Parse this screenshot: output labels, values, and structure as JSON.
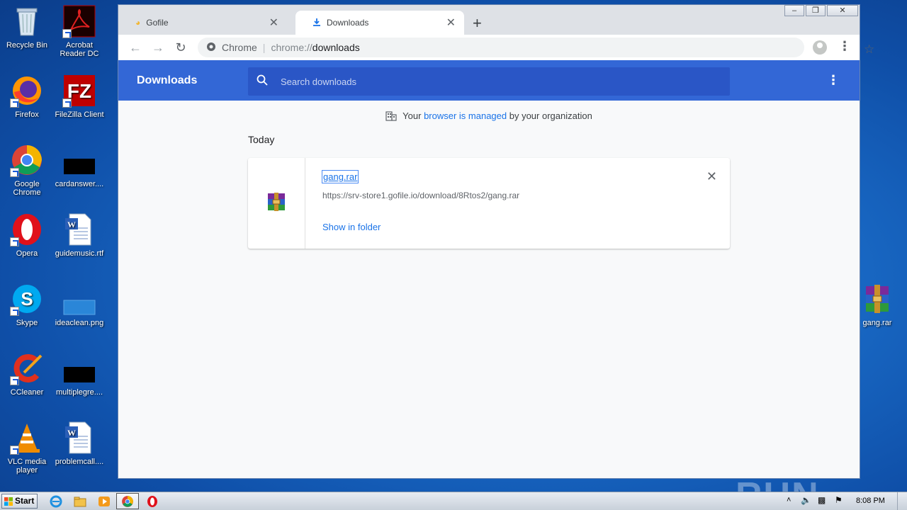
{
  "desktop": {
    "icons": [
      {
        "label": "Recycle Bin"
      },
      {
        "label": "Acrobat Reader DC"
      },
      {
        "label": "Firefox"
      },
      {
        "label": "FileZilla Client"
      },
      {
        "label": "Google Chrome"
      },
      {
        "label": "cardanswer...."
      },
      {
        "label": "Opera"
      },
      {
        "label": "guidemusic.rtf"
      },
      {
        "label": "Skype"
      },
      {
        "label": "ideaclean.png"
      },
      {
        "label": "CCleaner"
      },
      {
        "label": "multiplegre...."
      },
      {
        "label": "VLC media player"
      },
      {
        "label": "problemcall...."
      },
      {
        "label": "gang.rar"
      }
    ],
    "watermark": "ANY RUN"
  },
  "browser": {
    "tabs": [
      {
        "label": "Gofile",
        "active": false
      },
      {
        "label": "Downloads",
        "active": true
      }
    ],
    "omnibox": {
      "site_label": "Chrome",
      "scheme": "chrome://",
      "host": "downloads"
    },
    "page": {
      "title": "Downloads",
      "search_placeholder": "Search downloads",
      "managed": {
        "prefix": "Your ",
        "link": "browser is managed",
        "suffix": " by your organization"
      },
      "section_label": "Today",
      "downloads": [
        {
          "filename": "gang.rar",
          "url": "https://srv-store1.gofile.io/download/8Rtos2/gang.rar",
          "action": "Show in folder"
        }
      ]
    }
  },
  "taskbar": {
    "start_label": "Start",
    "clock": "8:08 PM"
  },
  "colors": {
    "header_blue": "#3367d6",
    "link_blue": "#1a73e8",
    "desktop_blue": "#1a6cc8"
  }
}
